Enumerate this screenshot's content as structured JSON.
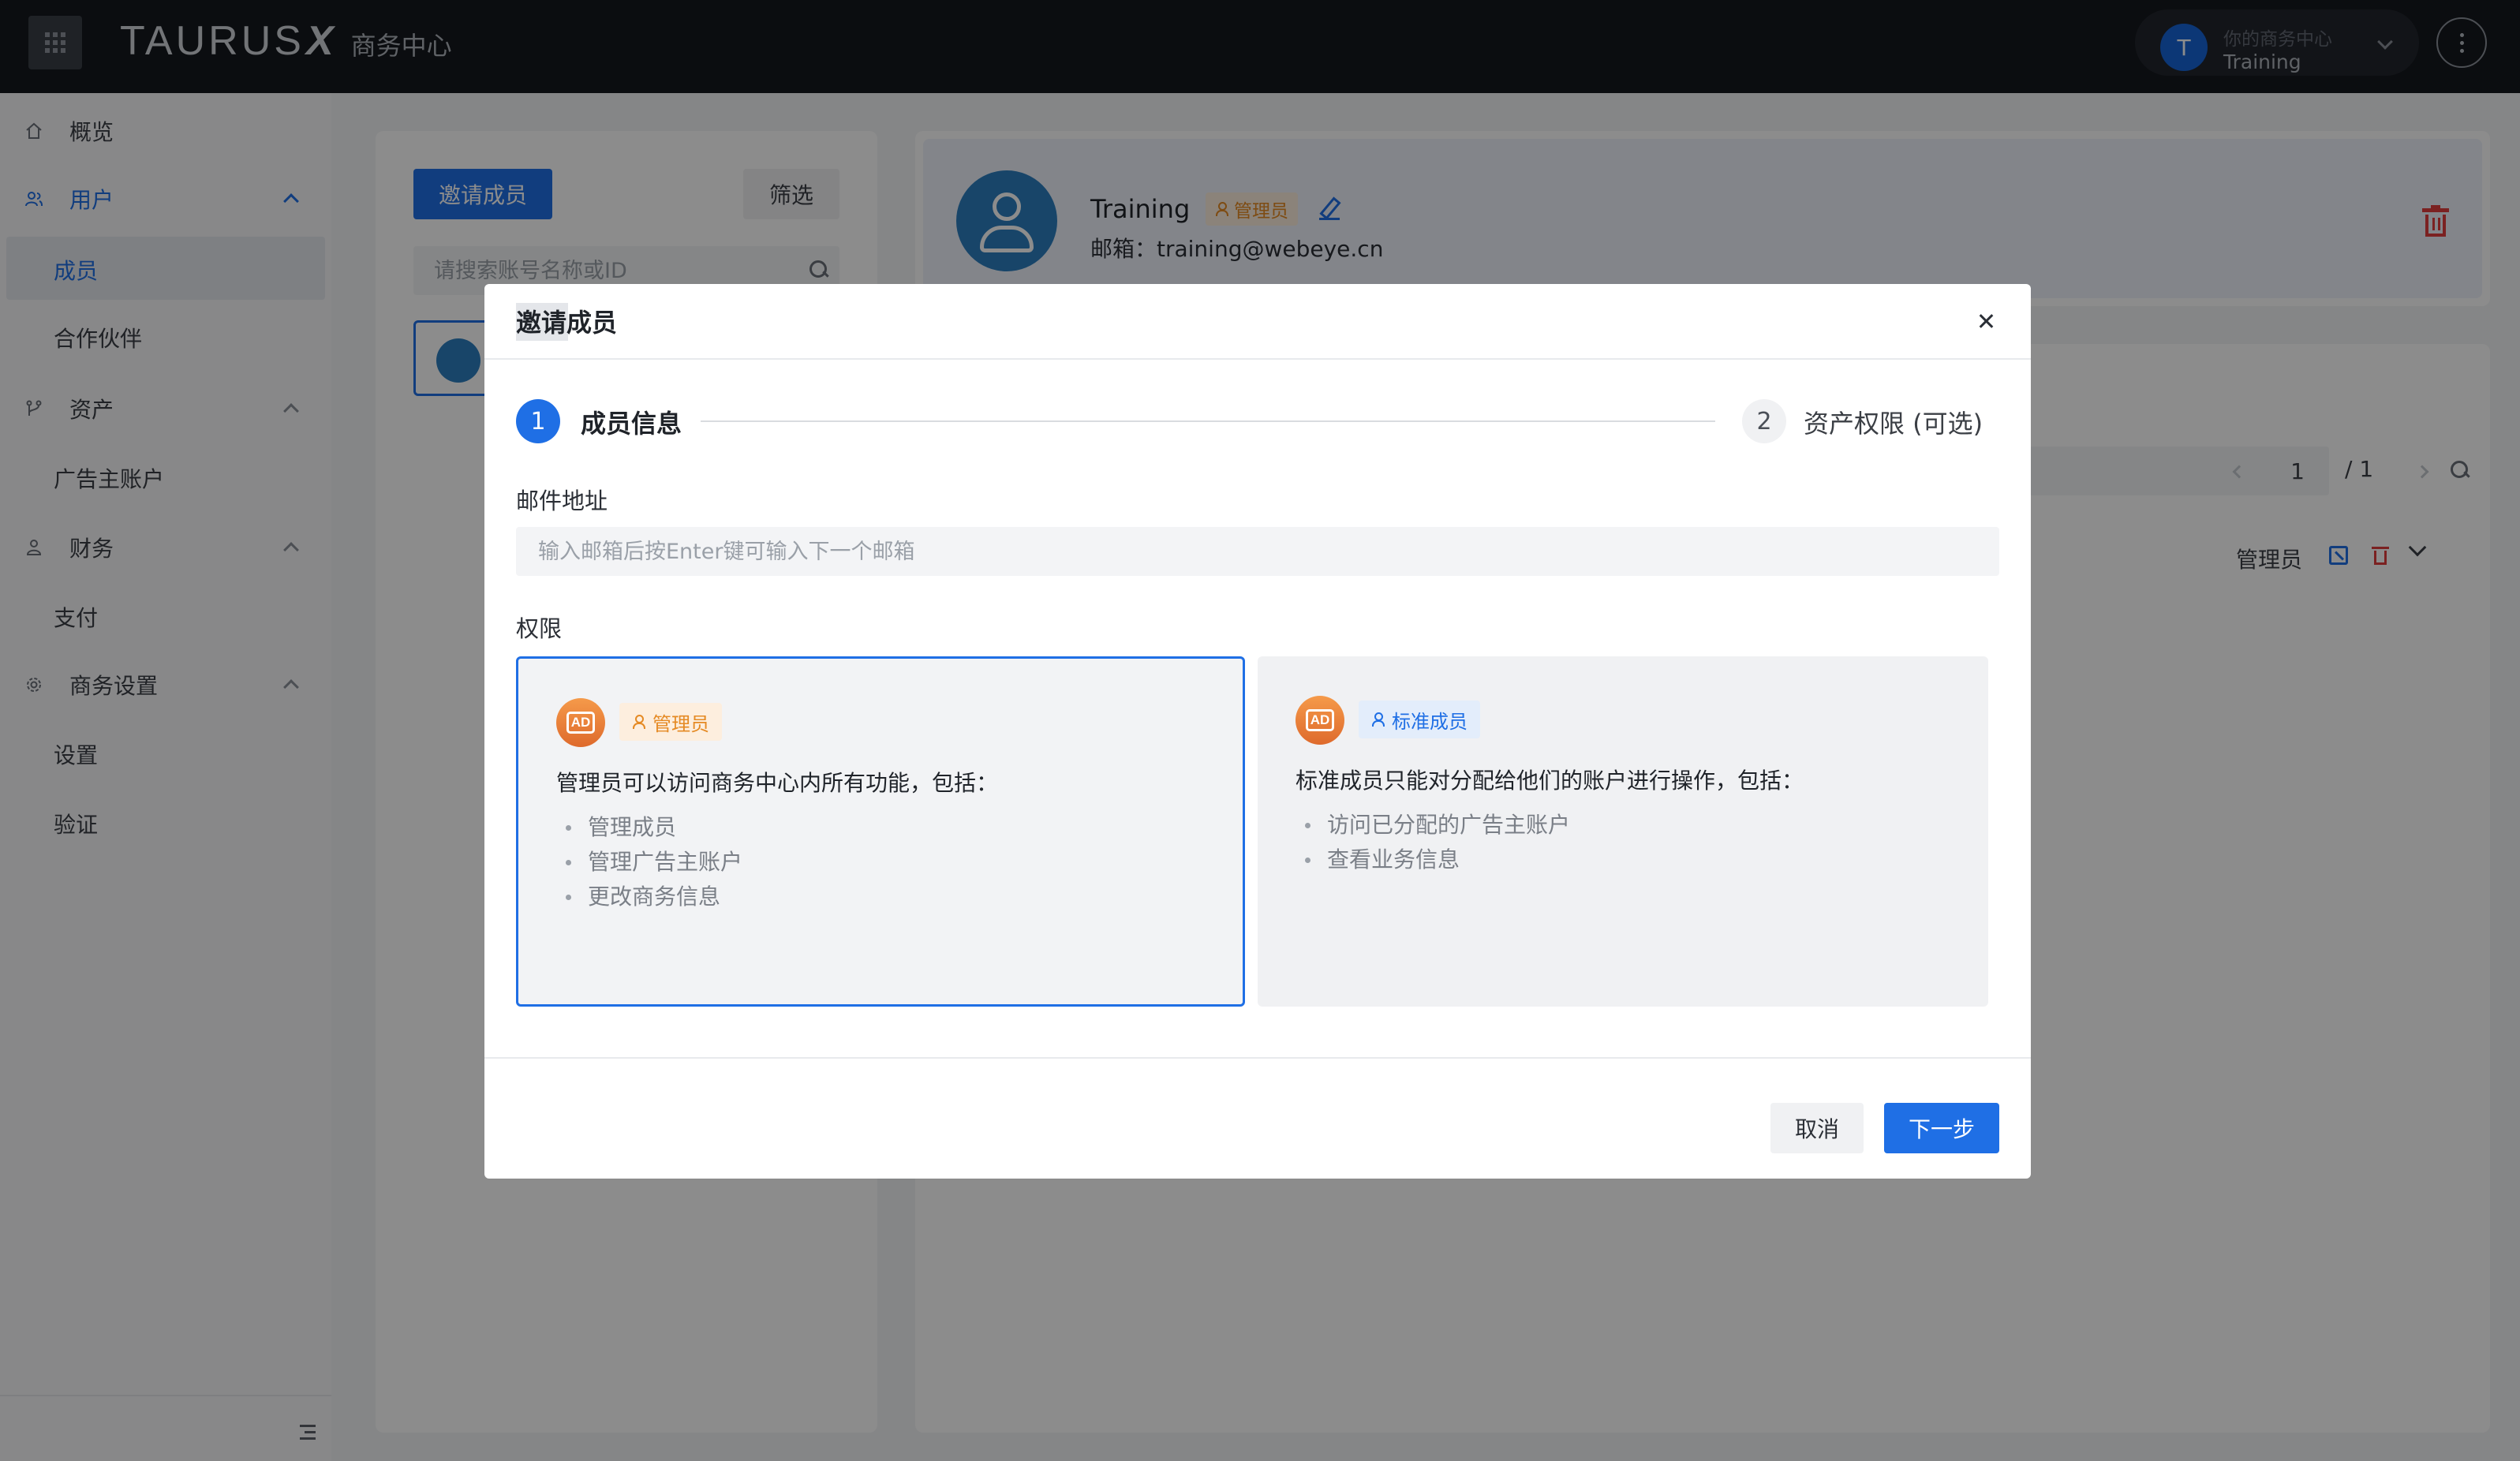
{
  "topbar": {
    "brand_logo": "TAURUS",
    "brand_x": "X",
    "brand_sub": "商务中心",
    "account_label": "你的商务中心",
    "account_name": "Training",
    "account_initial": "T"
  },
  "sidebar": {
    "items": [
      {
        "label": "概览",
        "icon": "home-icon"
      },
      {
        "label": "用户",
        "icon": "users-icon"
      },
      {
        "label": "成员"
      },
      {
        "label": "合作伙伴"
      },
      {
        "label": "资产",
        "icon": "branch-icon"
      },
      {
        "label": "广告主账户"
      },
      {
        "label": "财务",
        "icon": "finance-icon"
      },
      {
        "label": "支付"
      },
      {
        "label": "商务设置",
        "icon": "gear-icon"
      },
      {
        "label": "设置"
      },
      {
        "label": "验证"
      }
    ]
  },
  "members": {
    "invite_label": "邀请成员",
    "filter_label": "筛选",
    "search_placeholder": "请搜索账号名称或ID"
  },
  "detail": {
    "name": "Training",
    "role_badge": "管理员",
    "email": "邮箱：training@webeye.cn",
    "pager_current": "1",
    "pager_total": "/  1",
    "row_role": "管理员"
  },
  "modal": {
    "title": "邀请成员",
    "step1_number": "1",
    "step1_label": "成员信息",
    "step2_number": "2",
    "step2_label": "资产权限 (可选)",
    "email_label": "邮件地址",
    "email_placeholder": "输入邮箱后按Enter键可输入下一个邮箱",
    "permission_label": "权限",
    "admin": {
      "badge_text": "AD",
      "chip": "管理员",
      "desc": "管理员可以访问商务中心内所有功能，包括：",
      "items": [
        "管理成员",
        "管理广告主账户",
        "更改商务信息"
      ]
    },
    "standard": {
      "badge_text": "AD",
      "chip": "标准成员",
      "desc": "标准成员只能对分配给他们的账户进行操作，包括：",
      "items": [
        "访问已分配的广告主账户",
        "查看业务信息"
      ]
    },
    "cancel_label": "取消",
    "next_label": "下一步"
  },
  "colors": {
    "primary": "#1f6fe5",
    "admin_orange": "#e58a24",
    "danger": "#e03c3c",
    "topbar": "#15181e"
  }
}
